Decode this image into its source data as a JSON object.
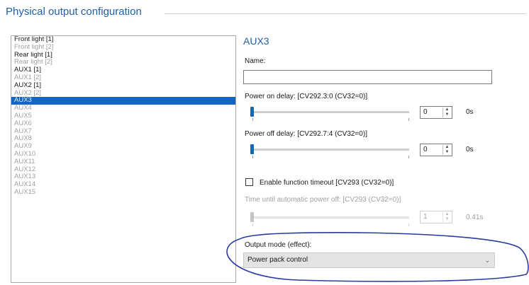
{
  "group": {
    "title": "Physical output configuration"
  },
  "outputs": [
    {
      "label": "Front light [1]",
      "dim": false
    },
    {
      "label": "Front light [2]",
      "dim": true
    },
    {
      "label": "Rear light [1]",
      "dim": false
    },
    {
      "label": "Rear light [2]",
      "dim": true
    },
    {
      "label": "AUX1 [1]",
      "dim": false
    },
    {
      "label": "AUX1 [2]",
      "dim": true
    },
    {
      "label": "AUX2 [1]",
      "dim": false
    },
    {
      "label": "AUX2 [2]",
      "dim": true
    },
    {
      "label": "AUX3",
      "dim": false,
      "selected": true
    },
    {
      "label": "AUX4",
      "dim": true
    },
    {
      "label": "AUX5",
      "dim": true
    },
    {
      "label": "AUX6",
      "dim": true
    },
    {
      "label": "AUX7",
      "dim": true
    },
    {
      "label": "AUX8",
      "dim": true
    },
    {
      "label": "AUX9",
      "dim": true
    },
    {
      "label": "AUX10",
      "dim": true
    },
    {
      "label": "AUX11",
      "dim": true
    },
    {
      "label": "AUX12",
      "dim": true
    },
    {
      "label": "AUX13",
      "dim": true
    },
    {
      "label": "AUX14",
      "dim": true
    },
    {
      "label": "AUX15",
      "dim": true
    }
  ],
  "detail": {
    "title": "AUX3",
    "name_label": "Name:",
    "name_value": "",
    "power_on": {
      "label": "Power on delay: [CV292.3:0 (CV32=0)]",
      "value": "0",
      "unit": "0s",
      "level": 0
    },
    "power_off": {
      "label": "Power off delay: [CV292.7:4 (CV32=0)]",
      "value": "0",
      "unit": "0s",
      "level": 0
    },
    "timeout": {
      "label": "Enable function timeout [CV293 (CV32=0)]",
      "checked": false
    },
    "auto_off": {
      "label": "Time until automatic power off: [CV293 (CV32=0)]",
      "value": "1",
      "unit": "0.41s",
      "level": 0
    },
    "output_mode": {
      "label": "Output mode (effect):",
      "value": "Power pack control"
    }
  },
  "colors": {
    "accent": "#1565c0",
    "title": "#1f5fa8",
    "annotation": "#2a3aa0"
  },
  "icons": {
    "spin_up": "▲",
    "spin_down": "▼",
    "dropdown": "⌄"
  }
}
